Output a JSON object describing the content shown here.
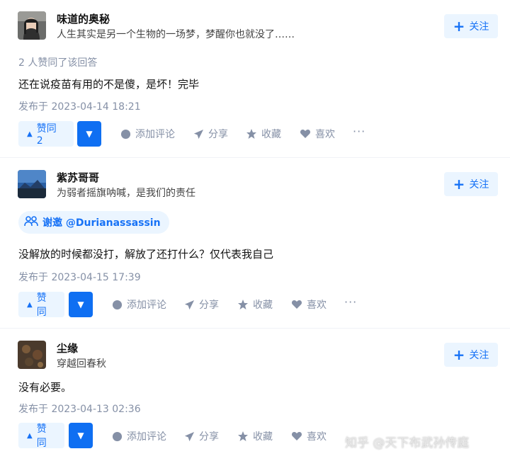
{
  "answers": [
    {
      "author": "味道的奥秘",
      "bio": "人生其实是另一个生物的一场梦，梦醒你也就没了……",
      "follow_label": "关注",
      "upvoters_text": "2 人赞同了该回答",
      "content": "还在说疫苗有用的不是傻，是坏！完毕",
      "time": "发布于 2023-04-14 18:21",
      "vote_label": "赞同 2",
      "actions": {
        "comment": "添加评论",
        "share": "分享",
        "favorite": "收藏",
        "like": "喜欢"
      }
    },
    {
      "author": "紫苏哥哥",
      "bio": "为弱者摇旗呐喊，是我们的责任",
      "follow_label": "关注",
      "invite_text": "谢邀 @Durianassassin",
      "content": "没解放的时候都没打，解放了还打什么？仅代表我自己",
      "time": "发布于 2023-04-15 17:39",
      "vote_label": "赞同",
      "actions": {
        "comment": "添加评论",
        "share": "分享",
        "favorite": "收藏",
        "like": "喜欢"
      }
    },
    {
      "author": "尘缘",
      "bio": "穿越回春秋",
      "follow_label": "关注",
      "content": "没有必要。",
      "time": "发布于 2023-04-13 02:36",
      "vote_label": "赞同",
      "actions": {
        "comment": "添加评论",
        "share": "分享",
        "favorite": "收藏",
        "like": "喜欢"
      }
    }
  ],
  "watermark": "知乎 @天下布武孙传庭",
  "colors": {
    "accent": "#1772f6",
    "accent_bg": "#ebf5ff",
    "muted": "#8590a6"
  },
  "icons": [
    "plus-icon",
    "triangle-up-icon",
    "triangle-down-icon",
    "comment-icon",
    "share-icon",
    "star-icon",
    "heart-icon",
    "more-icon",
    "invite-icon"
  ]
}
